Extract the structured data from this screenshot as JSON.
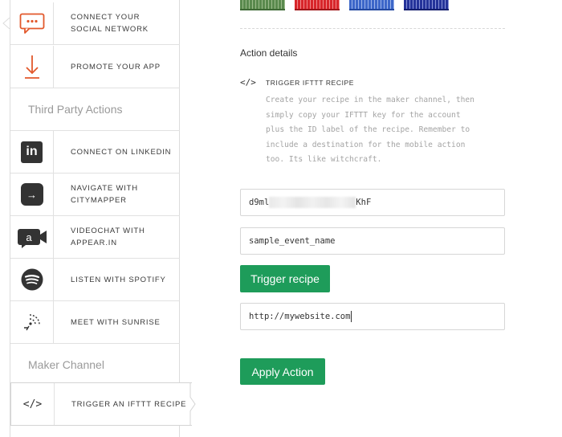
{
  "sidebar": {
    "items": [
      {
        "label_line1": "CONNECT YOUR",
        "label_line2": "SOCIAL NETWORK",
        "icon": "chat-bubble-icon"
      },
      {
        "label_line1": "PROMOTE YOUR APP",
        "label_line2": "",
        "icon": "download-arrow-icon"
      },
      {
        "label_line1": "CONNECT ON LINKEDIN",
        "label_line2": "",
        "icon": "linkedin-icon",
        "glyph": "in"
      },
      {
        "label_line1": "NAVIGATE WITH",
        "label_line2": "CITYMAPPER",
        "icon": "citymapper-icon",
        "glyph": "→"
      },
      {
        "label_line1": "VIDEOCHAT WITH",
        "label_line2": "APPEAR.IN",
        "icon": "appear-in-icon",
        "glyph": "a"
      },
      {
        "label_line1": "LISTEN WITH SPOTIFY",
        "label_line2": "",
        "icon": "spotify-icon"
      },
      {
        "label_line1": "MEET WITH SUNRISE",
        "label_line2": "",
        "icon": "sunrise-icon"
      },
      {
        "label_line1": "TRIGGER AN IFTTT RECIPE",
        "label_line2": "",
        "icon": "code-icon",
        "glyph": "</>"
      }
    ],
    "sections": {
      "third_party": "Third Party Actions",
      "maker": "Maker Channel"
    }
  },
  "main": {
    "section_title": "Action details",
    "trigger": {
      "icon_glyph": "</>",
      "title": "TRIGGER IFTTT RECIPE",
      "description": "Create your recipe in the maker channel, then simply copy your IFTTT key for the account plus the ID label of the recipe. Remember to include a destination for the mobile action too. Its like witchcraft."
    },
    "fields": {
      "key_start": "d9ml",
      "key_end": "KhF",
      "event_name": "sample_event_name",
      "url": "http://mywebsite.com"
    },
    "buttons": {
      "trigger": "Trigger recipe",
      "apply": "Apply Action"
    }
  },
  "colors": {
    "accent_green": "#1e9c5a",
    "icon_orange": "#e2582b",
    "icon_dark": "#333333",
    "swatches": [
      "#5a8a4e",
      "#d8262b",
      "#3d67c9",
      "#25339a"
    ]
  }
}
